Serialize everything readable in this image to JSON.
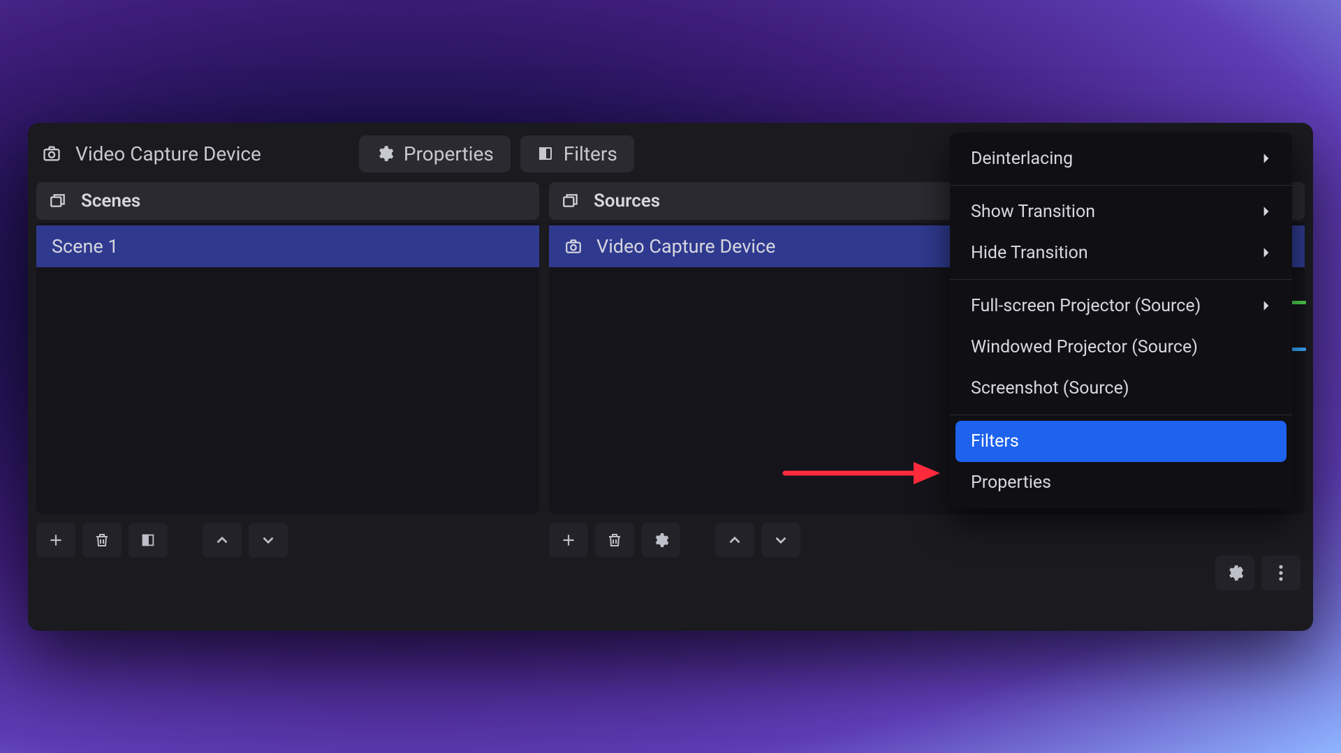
{
  "top": {
    "source_name": "Video Capture Device",
    "properties_label": "Properties",
    "filters_label": "Filters"
  },
  "scenes": {
    "header": "Scenes",
    "items": [
      "Scene 1"
    ]
  },
  "sources": {
    "header": "Sources",
    "items": [
      {
        "label": "Video Capture Device"
      }
    ]
  },
  "context_menu": {
    "deinterlacing": "Deinterlacing",
    "show_transition": "Show Transition",
    "hide_transition": "Hide Transition",
    "fullscreen_projector": "Full-screen Projector (Source)",
    "windowed_projector": "Windowed Projector (Source)",
    "screenshot": "Screenshot (Source)",
    "filters": "Filters",
    "properties": "Properties"
  },
  "colors": {
    "highlight": "#1d63ed",
    "selection": "#2f3a8f",
    "panel_bg": "#1a1a1f",
    "arrow": "#ff2a3c"
  }
}
